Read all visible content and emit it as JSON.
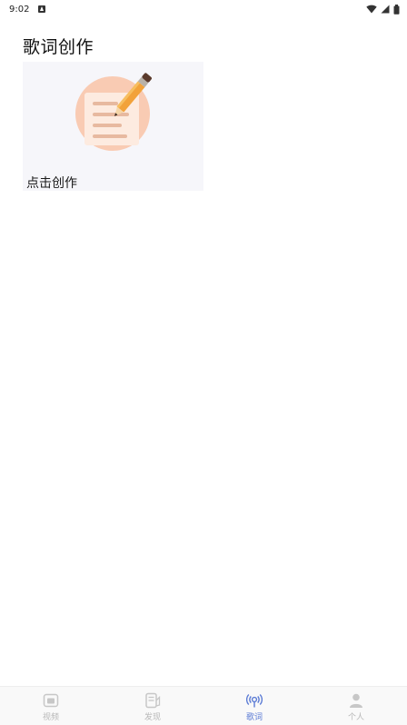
{
  "status_bar": {
    "time": "9:02",
    "notification_icon": "notification-icon",
    "wifi_icon": "wifi-icon",
    "signal_icon": "signal-icon",
    "battery_icon": "battery-icon"
  },
  "page": {
    "title": "歌词创作"
  },
  "create_card": {
    "label": "点击创作",
    "icon": "pencil-note-icon",
    "colors": {
      "card_bg": "#f6f6fa",
      "circle": "#f9cbb3",
      "paper": "#fdebe0",
      "lines": "#e7b9a0",
      "pencil": "#f2a23a"
    }
  },
  "bottom_nav": {
    "active_color": "#5b7bd5",
    "inactive_color": "#b8b8b8",
    "items": [
      {
        "label": "视频",
        "icon": "video-icon",
        "active": false
      },
      {
        "label": "发现",
        "icon": "discover-icon",
        "active": false
      },
      {
        "label": "歌词",
        "icon": "lyrics-icon",
        "active": true
      },
      {
        "label": "个人",
        "icon": "profile-icon",
        "active": false
      }
    ]
  }
}
